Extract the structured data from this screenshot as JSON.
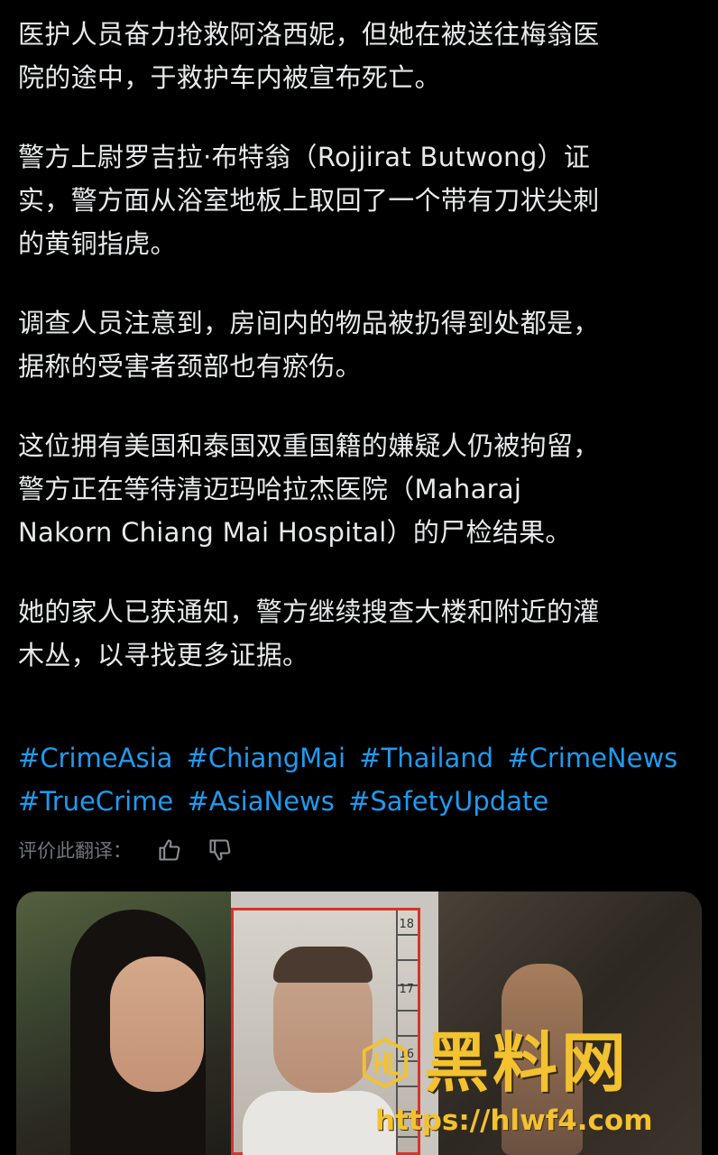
{
  "post": {
    "paragraphs": [
      "医护人员奋力抢救阿洛西妮，但她在被送往梅翁医\n院的途中，于救护车内被宣布死亡。",
      "警方上尉罗吉拉·布特翁（Rojjirat Butwong）证\n实，警方面从浴室地板上取回了一个带有刀状尖刺\n的黄铜指虎。",
      "调查人员注意到，房间内的物品被扔得到处都是，\n据称的受害者颈部也有瘀伤。",
      "这位拥有美国和泰国双重国籍的嫌疑人仍被拘留，\n警方正在等待清迈玛哈拉杰医院（Maharaj\nNakorn Chiang Mai Hospital）的尸检结果。",
      "她的家人已获通知，警方继续搜查大楼和附近的灌\n木丛，以寻找更多证据。"
    ],
    "hashtags": [
      "#CrimeAsia",
      "#ChiangMai",
      "#Thailand",
      "#CrimeNews",
      "#TrueCrime",
      "#AsiaNews",
      "#SafetyUpdate"
    ]
  },
  "translation_rating": {
    "label": "评价此翻译：",
    "thumbs_up_icon": "thumbs-up-icon",
    "thumbs_down_icon": "thumbs-down-icon"
  },
  "media": {
    "watermark_text": "黑料网",
    "watermark_url": "https://hlwf4.com",
    "height_scale_labels": [
      "18",
      "17",
      "16"
    ]
  },
  "colors": {
    "background": "#000000",
    "text": "#e7e9ea",
    "link": "#1d9bf0",
    "muted": "#71767b",
    "watermark": "#f2c230"
  }
}
